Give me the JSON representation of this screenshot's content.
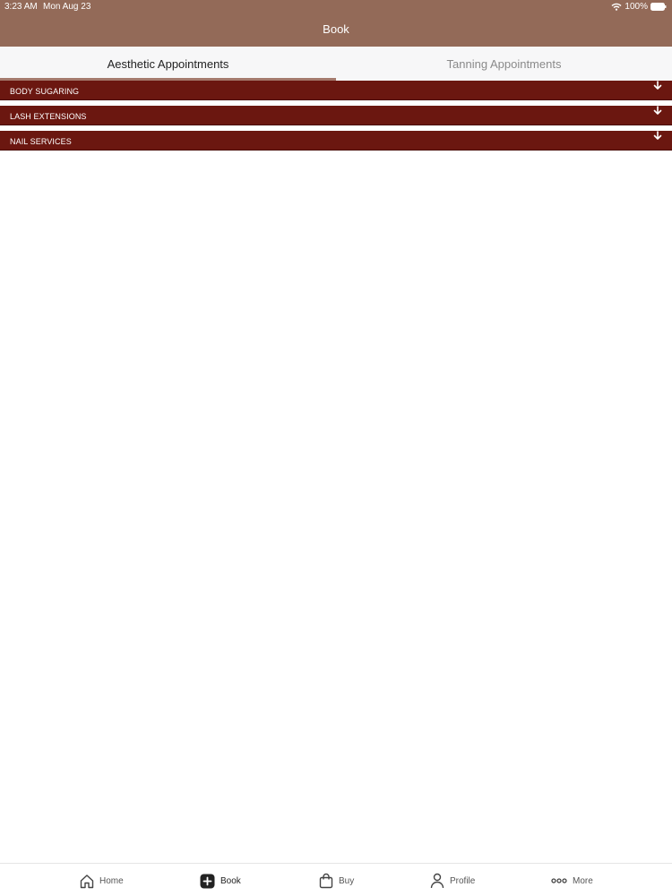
{
  "status_bar": {
    "time": "3:23 AM",
    "date": "Mon Aug 23",
    "battery": "100%"
  },
  "nav": {
    "title": "Book"
  },
  "tabs": [
    {
      "label": "Aesthetic Appointments",
      "active": true
    },
    {
      "label": "Tanning Appointments",
      "active": false
    }
  ],
  "sections": [
    {
      "label": "BODY SUGARING"
    },
    {
      "label": "LASH EXTENSIONS"
    },
    {
      "label": "NAIL SERVICES"
    }
  ],
  "bottom_tabs": [
    {
      "label": "Home",
      "icon": "home-icon"
    },
    {
      "label": "Book",
      "icon": "plus-square-icon",
      "active": true
    },
    {
      "label": "Buy",
      "icon": "shopping-bag-icon"
    },
    {
      "label": "Profile",
      "icon": "person-icon"
    },
    {
      "label": "More",
      "icon": "more-dots-icon"
    }
  ],
  "colors": {
    "header": "#936a58",
    "section_bar": "#6b1710",
    "tab_indicator": "#a47a6d"
  }
}
